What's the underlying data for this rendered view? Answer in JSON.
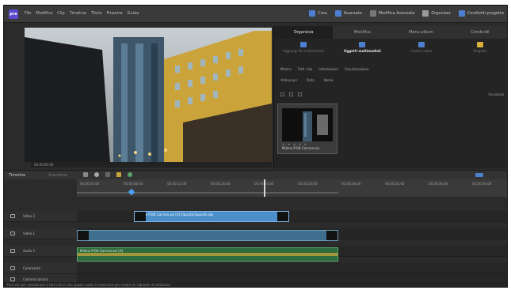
{
  "app": {
    "logo_text": "pre",
    "accent_color": "#5b4ad1"
  },
  "menubar": {
    "menus": [
      "File",
      "Modifica",
      "Clip",
      "Timeline",
      "Titolo",
      "Finestra",
      "Guida"
    ],
    "actions": [
      {
        "label": "Crea",
        "icon": "disc-icon",
        "color": "#4e7fd0"
      },
      {
        "label": "Avanzato",
        "icon": "wand-icon",
        "color": "#4e7fd0"
      },
      {
        "label": "Modifica Avanzata",
        "icon": "edit-icon",
        "color": "#777777"
      },
      {
        "label": "Organizer",
        "icon": "organizer-icon",
        "color": "#9a9a9a"
      },
      {
        "label": "Condividi progetto",
        "icon": "share-icon",
        "color": "#4e7fd0"
      }
    ]
  },
  "monitor": {
    "timecode": "00:00:00:00"
  },
  "panel": {
    "tabs": [
      "Organizza",
      "Modifica",
      "Menu album",
      "Condividi"
    ],
    "active_tab": 0,
    "media_buttons": [
      {
        "label": "Aggiungi file multimediali",
        "icon": "import-icon",
        "color": "#4e7fd0"
      },
      {
        "label": "Oggetti multimediali",
        "icon": "media-icon",
        "color": "#4e7fd0"
      },
      {
        "label": "Cattura video",
        "icon": "camera-icon",
        "color": "#4e7fd0"
      },
      {
        "label": "Progetto",
        "icon": "folder-icon",
        "color": "#d9b03a"
      }
    ],
    "active_media": 1,
    "filters_row1": [
      "Mostra",
      "Tutti i tipi",
      "Informazioni",
      "Visualizzazione"
    ],
    "filters_row2": [
      "Ordina per",
      "Data",
      "Nome"
    ],
    "view_label": "Visualizza",
    "clip": {
      "stars": "★ ★ ★ ★ ★",
      "name": "Milano P.Gtt.Carrara.avi"
    }
  },
  "timeline": {
    "tabs": [
      "Timeline",
      "Sceneline"
    ],
    "ruler_labels": [
      "00;00;04;00",
      "00;00;08;00",
      "00;00;12;00",
      "00;00;16;00",
      "00;00;20;00",
      "00;00;24;00",
      "00;00;28;00",
      "00;00;32;00",
      "00;00;36;00",
      "00;00;40;00"
    ],
    "tracks": [
      {
        "name": "Video 2",
        "icon": "video-track-icon"
      },
      {
        "name": "Video 1",
        "icon": "video-track-icon"
      },
      {
        "name": "Audio 1",
        "icon": "audio-track-icon"
      },
      {
        "name": "Commento",
        "icon": "audio-track-icon"
      },
      {
        "name": "Colonna sonora",
        "icon": "audio-track-icon"
      }
    ],
    "clips": {
      "video2_label": "Milano P.Gtt.Carrara.avi [V] Opacità:Opacità clip",
      "audio1_label": "Milano P.Gtt.Carrara.avi [A]"
    },
    "status": "Fare clic per selezionare o fare clic in uno spazio vuoto e trascinare per creare un riquadro di selezione."
  }
}
